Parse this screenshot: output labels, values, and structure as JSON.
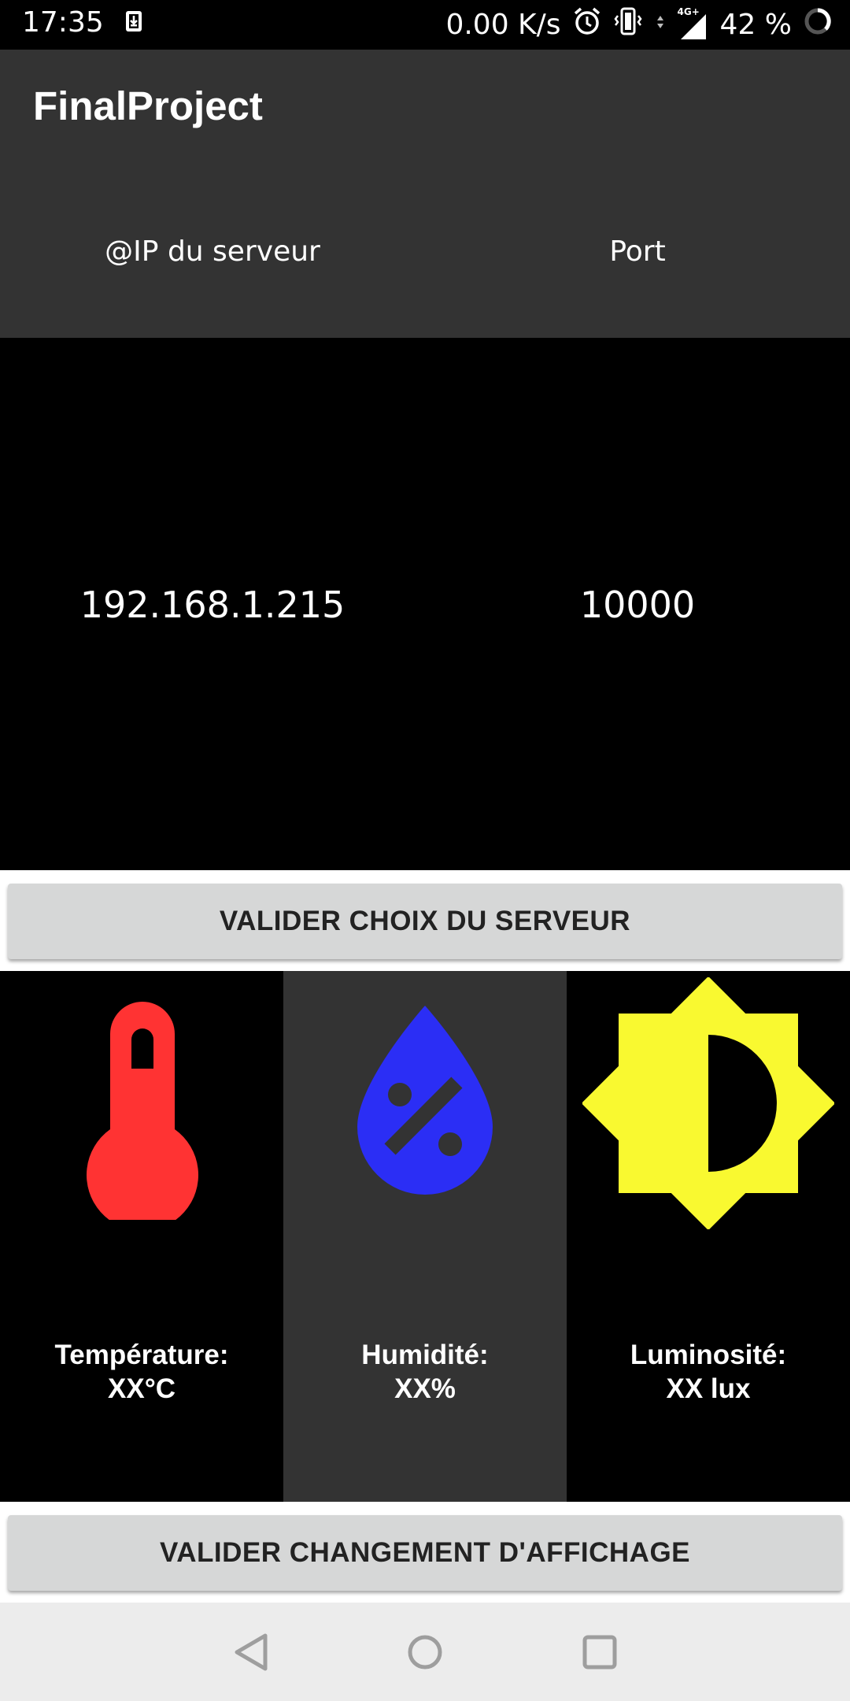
{
  "status_bar": {
    "time": "17:35",
    "speed": "0.00 K/s",
    "network": "4G+",
    "battery": "42 %",
    "icons": [
      "download-icon",
      "alarm-icon",
      "vibrate-icon",
      "data-arrows-icon",
      "signal-icon",
      "battery-icon"
    ]
  },
  "app_bar": {
    "title": "FinalProject"
  },
  "server": {
    "ip_label": "@IP du serveur",
    "port_label": "Port",
    "ip_value": "192.168.1.215",
    "port_value": "10000"
  },
  "buttons": {
    "validate_server": "VALIDER CHOIX DU SERVEUR",
    "validate_display": "VALIDER CHANGEMENT D'AFFICHAGE"
  },
  "sensors": [
    {
      "label_line1": "Température:",
      "label_line2": "XX°C",
      "icon": "thermometer-icon",
      "color": "#ff3333"
    },
    {
      "label_line1": "Humidité:",
      "label_line2": "XX%",
      "icon": "humidity-drop-icon",
      "color": "#2b2ef5"
    },
    {
      "label_line1": "Luminosité:",
      "label_line2": "XX lux",
      "icon": "brightness-icon",
      "color": "#f9f930"
    }
  ],
  "nav_bar": {
    "icons": [
      "back-icon",
      "home-icon",
      "recents-icon"
    ]
  },
  "colors": {
    "app_bar_bg": "#333333",
    "button_bg": "#d6d7d7",
    "nav_bg": "#ececec"
  }
}
